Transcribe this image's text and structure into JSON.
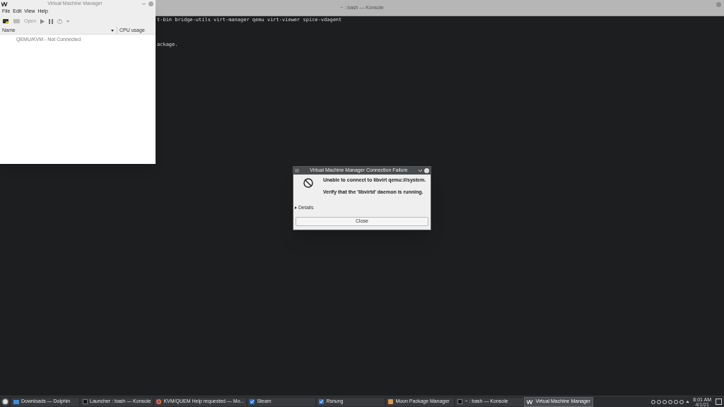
{
  "terminal": {
    "title": "~ : bash — Konsole",
    "lines": [
      "t-bin bridge-utils virt-manager qemu virt-viewer spice-vdagent",
      "ackage."
    ]
  },
  "vmm": {
    "title": "Virtual Machine Manager",
    "menu": [
      "File",
      "Edit",
      "View",
      "Help"
    ],
    "toolbar": {
      "open": "Open"
    },
    "columns": [
      "Name",
      "CPU usage"
    ],
    "rows": [
      {
        "name": "QEMU/KVM - Not Connected"
      }
    ]
  },
  "dialog": {
    "title": "Virtual Machine Manager Connection Failure",
    "message": "Unable to connect to libvirt qemu:///system.",
    "hint": "Verify that the 'libvirtd' daemon is running.",
    "details": {
      "label": "Details",
      "expanded": false
    },
    "button": "Close"
  },
  "taskbar": {
    "tasks": [
      {
        "label": "Downloads — Dolphin",
        "kind": "folder",
        "selected": false
      },
      {
        "label": "Launcher : bash — Konsole",
        "kind": "terminal",
        "selected": false
      },
      {
        "label": "KVM/QUEM Help requested — Mo...",
        "kind": "browser",
        "selected": false
      },
      {
        "label": "Steam",
        "kind": "check",
        "selected": false
      },
      {
        "label": "Rsnung",
        "kind": "check",
        "selected": false
      },
      {
        "label": "Muon Package Manager",
        "kind": "package",
        "selected": false
      },
      {
        "label": "~ : bash — Konsole",
        "kind": "terminal",
        "selected": false
      },
      {
        "label": "Virtual Machine Manager",
        "kind": "vm",
        "selected": true
      }
    ],
    "time": "8:01 AM",
    "date": "4/1/21"
  }
}
